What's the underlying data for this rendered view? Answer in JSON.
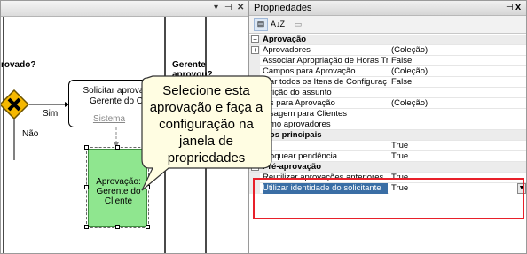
{
  "designer": {
    "toolbar_icons": [
      "dropdown-arrow-icon",
      "pin-icon",
      "close-icon"
    ],
    "toolbar_glyphs": {
      "dropdown": "▾",
      "pin": "⊣",
      "close": "✕"
    },
    "caption_left": "rovado?",
    "caption_right": "Gerente aprovou?",
    "flow_yes": "Sim",
    "flow_no": "Não",
    "task_title_line1": "Solicitar aprovação",
    "task_title_line2": "Gerente do Clie",
    "task_system": "Sistema",
    "approval_task_line1": "Aprovação:",
    "approval_task_line2": "Gerente do",
    "approval_task_line3": "Cliente",
    "callout": "Selecione esta aprovação e faça a configuração na janela de propriedades",
    "colors": {
      "gateway": "#f5b800",
      "approval_fill": "#8fe68f",
      "callout_fill": "#fffde2",
      "callout_stroke": "#333333"
    }
  },
  "properties": {
    "title": "Propriedades",
    "pin_glyph": "⊣",
    "close_glyph": "x",
    "toolbar": {
      "categorized_glyph": "▤",
      "alphabetical_glyph": "A↓Z",
      "pages_glyph": "▭"
    },
    "rows": [
      {
        "type": "category",
        "name": "Aprovação",
        "expander": "−"
      },
      {
        "type": "prop",
        "name": "Aprovadores",
        "value": "(Coleção)",
        "expander": "+"
      },
      {
        "type": "prop",
        "name": "Associar Apropriação de Horas Trab",
        "value": "False"
      },
      {
        "type": "prop",
        "name": "Campos para Aprovação",
        "value": "(Coleção)"
      },
      {
        "type": "prop",
        "name": "...ar todos os Itens de Configuraç",
        "value": "False"
      },
      {
        "type": "prop",
        "name": "...rição do assunto",
        "value": ""
      },
      {
        "type": "prop",
        "name": "...s para Aprovação",
        "value": "(Coleção)"
      },
      {
        "type": "prop",
        "name": "...sagem para Clientes",
        "value": ""
      },
      {
        "type": "prop",
        "name": "...mo aprovadores",
        "value": ""
      },
      {
        "type": "category",
        "name": "...os principais",
        "expander": "−"
      },
      {
        "type": "prop",
        "name": "...",
        "value": "True"
      },
      {
        "type": "prop",
        "name": "...oquear pendência",
        "value": "True"
      },
      {
        "type": "category",
        "name": "Pré-aprovação",
        "expander": "−"
      },
      {
        "type": "prop",
        "name": "Reutilizar aprovações anteriores",
        "value": "True"
      },
      {
        "type": "prop",
        "name": "Utilizar identidade do solicitante",
        "value": "True",
        "selected": true,
        "dropdown": "▼"
      }
    ],
    "colors": {
      "selection": "#3a6ea5",
      "highlight_border": "#e8202a"
    }
  }
}
